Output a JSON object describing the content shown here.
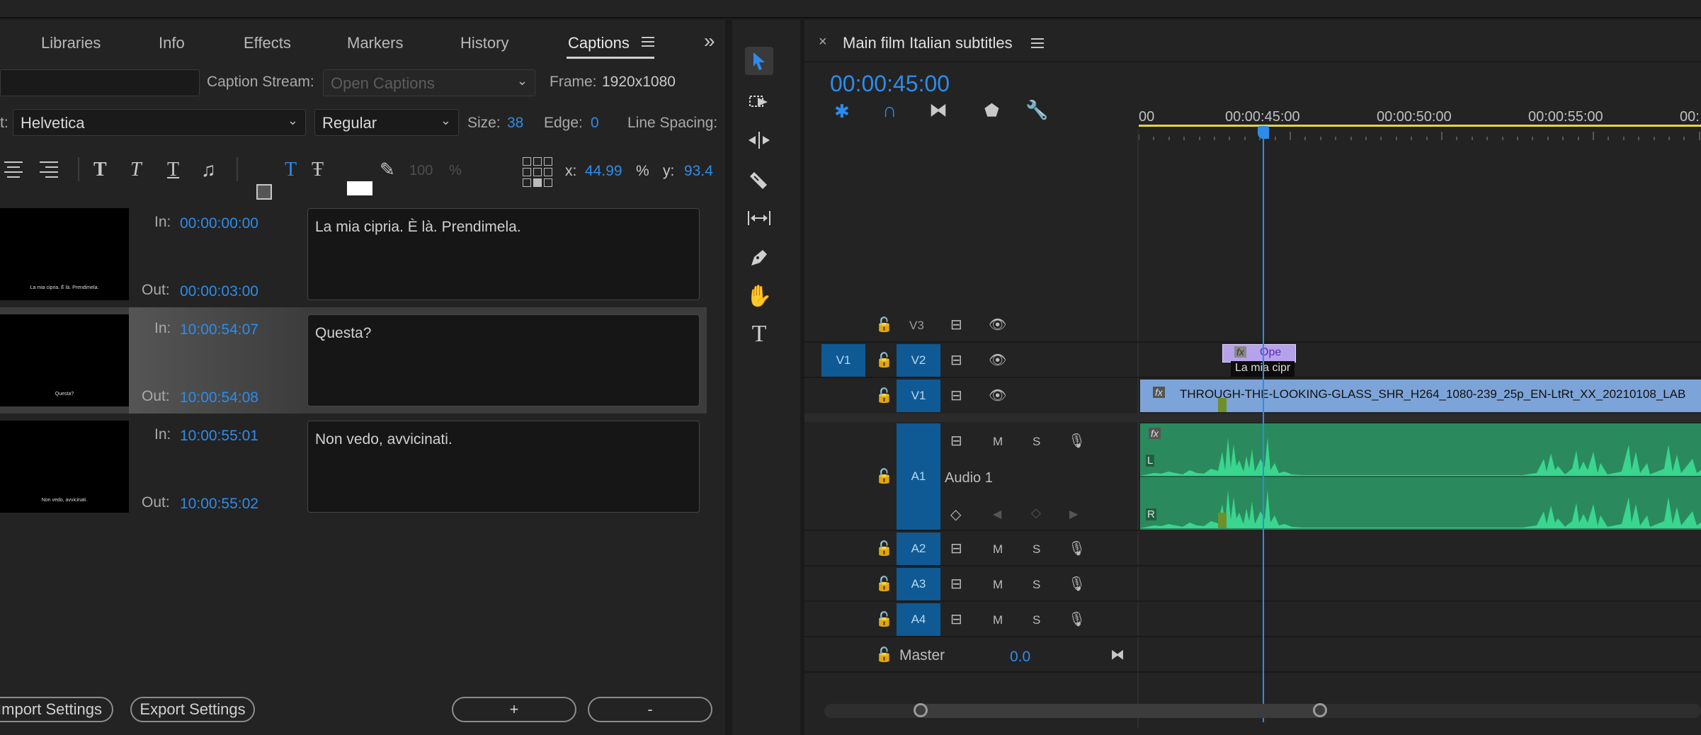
{
  "captions_panel": {
    "tabs": [
      "Libraries",
      "Info",
      "Effects",
      "Markers",
      "History",
      "Captions"
    ],
    "overflow_icon": "double-chevron-right-icon",
    "caption_stream_label": "Caption Stream:",
    "caption_stream_value": "Open Captions",
    "frame_label": "Frame:",
    "frame_value": "1920x1080",
    "font_label": "t:",
    "font_value": "Helvetica",
    "style_value": "Regular",
    "size_label": "Size:",
    "size_value": "38",
    "edge_label": "Edge:",
    "edge_value": "0",
    "line_spacing_label": "Line Spacing:",
    "opacity_value": "100",
    "opacity_unit": "%",
    "x_label": "x:",
    "x_value": "44.99",
    "x_unit": "%",
    "y_label": "y:",
    "y_value": "93.4",
    "in_label": "In:",
    "out_label": "Out:",
    "captions": [
      {
        "in": "00:00:00:00",
        "out": "00:00:03:00",
        "text": "La mia cipria. È là. Prendimela.",
        "thumb_text": "La mia cipria. È là. Prendimela."
      },
      {
        "in": "10:00:54:07",
        "out": "10:00:54:08",
        "text": "Questa?",
        "thumb_text": "Questa?"
      },
      {
        "in": "10:00:55:01",
        "out": "10:00:55:02",
        "text": "Non vedo, avvicinati.",
        "thumb_text": "Non vedo, avvicinati."
      }
    ],
    "import_settings": "Import Settings",
    "export_settings": "Export Settings",
    "add_button": "+",
    "remove_button": "-"
  },
  "timeline": {
    "title": "Main film Italian subtitles",
    "timecode": "00:00:45:00",
    "ruler": [
      "00",
      "00:00:45:00",
      "00:00:50:00",
      "00:00:55:00",
      "00:"
    ],
    "tracks_video": [
      {
        "source": "",
        "name": "V3"
      },
      {
        "source": "V1",
        "name": "V2"
      },
      {
        "source": "",
        "name": "V1"
      }
    ],
    "audio_name": "Audio 1",
    "tracks_audio": [
      "A1",
      "A2",
      "A3",
      "A4"
    ],
    "m_label": "M",
    "s_label": "S",
    "master_label": "Master",
    "master_value": "0.0",
    "caption_clip_label": "Ope",
    "caption_clip_tooltip": "La mia cipr",
    "video_clip_name": "THROUGH-THE-LOOKING-GLASS_SHR_H264_1080-239_25p_EN-LtRt_XX_20210108_LAB",
    "fx_label": "fx",
    "left_channel": "L",
    "right_channel": "R"
  },
  "colors": {
    "accent": "#2d8ceb",
    "video_clip": "#7da4d8",
    "audio_clip": "#2a8a5e",
    "caption_clip": "#b6a2e8",
    "track_target": "#0f5a94",
    "in_out_bar": "#e8d33a"
  }
}
